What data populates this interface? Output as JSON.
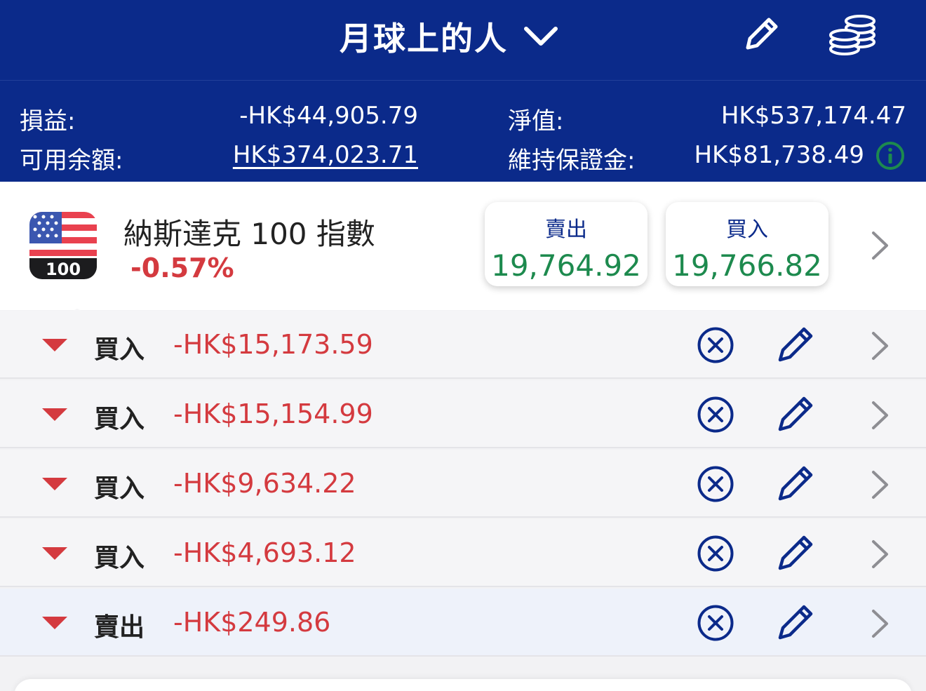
{
  "header": {
    "title": "月球上的人",
    "icons": {
      "dropdown": "chevron-down-icon",
      "edit": "pencil-icon",
      "coins": "coins-icon"
    }
  },
  "summary": {
    "pnl_label": "損益:",
    "pnl_value": "-HK$44,905.79",
    "equity_label": "淨值:",
    "equity_value": "HK$537,174.47",
    "available_label": "可用余額:",
    "available_value": "HK$374,023.71",
    "margin_label": "維持保證金:",
    "margin_value": "HK$81,738.49",
    "colors": {
      "background": "#0b2a8a",
      "info": "#1d8a4e"
    }
  },
  "instrument": {
    "flag_label": "100",
    "name": "納斯達克 100 指數",
    "change": "-0.57%",
    "sell": {
      "label": "賣出",
      "price": "19,764.92"
    },
    "buy": {
      "label": "買入",
      "price": "19,766.82"
    }
  },
  "positions": [
    {
      "direction": "買入",
      "pnl": "-HK$15,173.59"
    },
    {
      "direction": "買入",
      "pnl": "-HK$15,154.99"
    },
    {
      "direction": "買入",
      "pnl": "-HK$9,634.22"
    },
    {
      "direction": "買入",
      "pnl": "-HK$4,693.12"
    },
    {
      "direction": "賣出",
      "pnl": "-HK$249.86"
    }
  ],
  "colors": {
    "negative": "#d43a3f",
    "positive": "#1d8a4e",
    "brand": "#0b2a8a"
  }
}
